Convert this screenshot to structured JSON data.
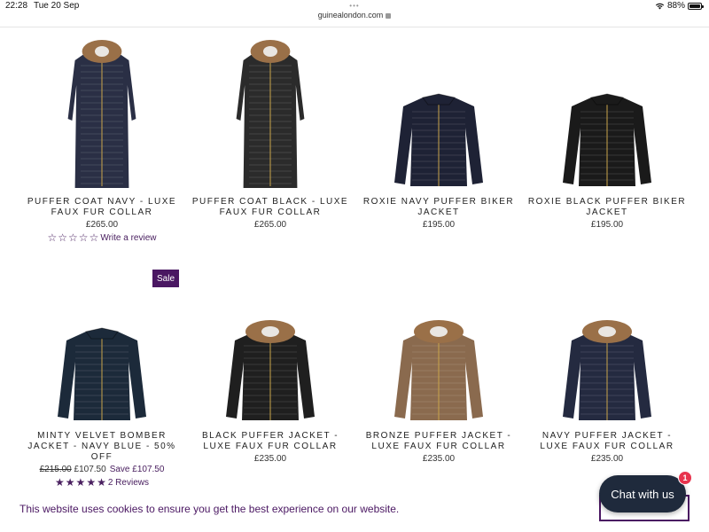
{
  "status_bar": {
    "time": "22:28",
    "date": "Tue 20 Sep",
    "battery": "88%",
    "battery_level": 0.88
  },
  "browser": {
    "url": "guinealondon.com"
  },
  "products": [
    {
      "title": "PUFFER COAT NAVY - LUXE FAUX FUR COLLAR",
      "price": "£265.00",
      "review_text": "Write a review",
      "stars_filled": 0,
      "color": "#2a2f45",
      "fur": true,
      "length": "long"
    },
    {
      "title": "PUFFER COAT BLACK - LUXE FAUX FUR COLLAR",
      "price": "£265.00",
      "color": "#2b2b2b",
      "fur": true,
      "length": "long"
    },
    {
      "title": "ROXIE NAVY PUFFER BIKER JACKET",
      "price": "£195.00",
      "color": "#1e2235",
      "fur": false,
      "length": "short"
    },
    {
      "title": "ROXIE BLACK PUFFER BIKER JACKET",
      "price": "£195.00",
      "color": "#1a1a1a",
      "fur": false,
      "length": "short"
    },
    {
      "title": "MINTY VELVET BOMBER JACKET - NAVY BLUE - 50% OFF",
      "old_price": "£215.00",
      "price": "£107.50",
      "save": "Save £107.50",
      "review_text": "2 Reviews",
      "stars_filled": 5,
      "badge": "Sale",
      "color": "#1c2a3a",
      "fur": false,
      "length": "bomber"
    },
    {
      "title": "BLACK PUFFER JACKET - LUXE FAUX FUR COLLAR",
      "price": "£235.00",
      "color": "#1f1f1f",
      "fur": true,
      "length": "short"
    },
    {
      "title": "BRONZE PUFFER JACKET - LUXE FAUX FUR COLLAR",
      "price": "£235.00",
      "color": "#8a6a4e",
      "fur": true,
      "length": "short"
    },
    {
      "title": "NAVY PUFFER JACKET - LUXE FAUX FUR COLLAR",
      "price": "£235.00",
      "color": "#242a40",
      "fur": true,
      "length": "short"
    }
  ],
  "cookie": {
    "text": "This website uses cookies to ensure you get the best experience on our website."
  },
  "chat": {
    "label": "Chat with us",
    "badge": "1"
  },
  "colors": {
    "accent": "#4a1762",
    "chat_bg": "#1f2a3c",
    "badge_red": "#e8344e"
  }
}
